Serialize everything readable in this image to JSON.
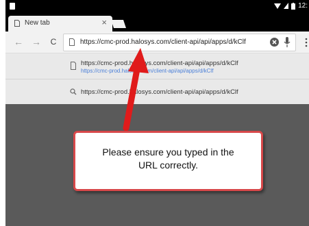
{
  "status_bar": {
    "time": "12:"
  },
  "tab": {
    "title": "New tab",
    "close_glyph": "×"
  },
  "toolbar": {
    "back_glyph": "←",
    "forward_glyph": "→",
    "reload_glyph": "C"
  },
  "omnibox": {
    "value": "https://cmc-prod.halosys.com/client-api/api/apps/d/kClf"
  },
  "suggestions": [
    {
      "icon": "page-icon",
      "title": "https://cmc-prod.halosys.com/client-api/api/apps/d/kClf",
      "url": "https://cmc-prod.halosys.com/client-api/api/apps/d/kClf"
    },
    {
      "icon": "search-icon",
      "title": "https://cmc-prod.halosys.com/client-api/api/apps/d/kClf"
    }
  ],
  "annotation": {
    "line1": "Please ensure you typed in the",
    "line2": "URL correctly."
  },
  "colors": {
    "arrow": "#e01b1b",
    "callout_border": "#d7484a",
    "page_background": "#5a5a5a",
    "link_blue": "#4a7fd8"
  }
}
